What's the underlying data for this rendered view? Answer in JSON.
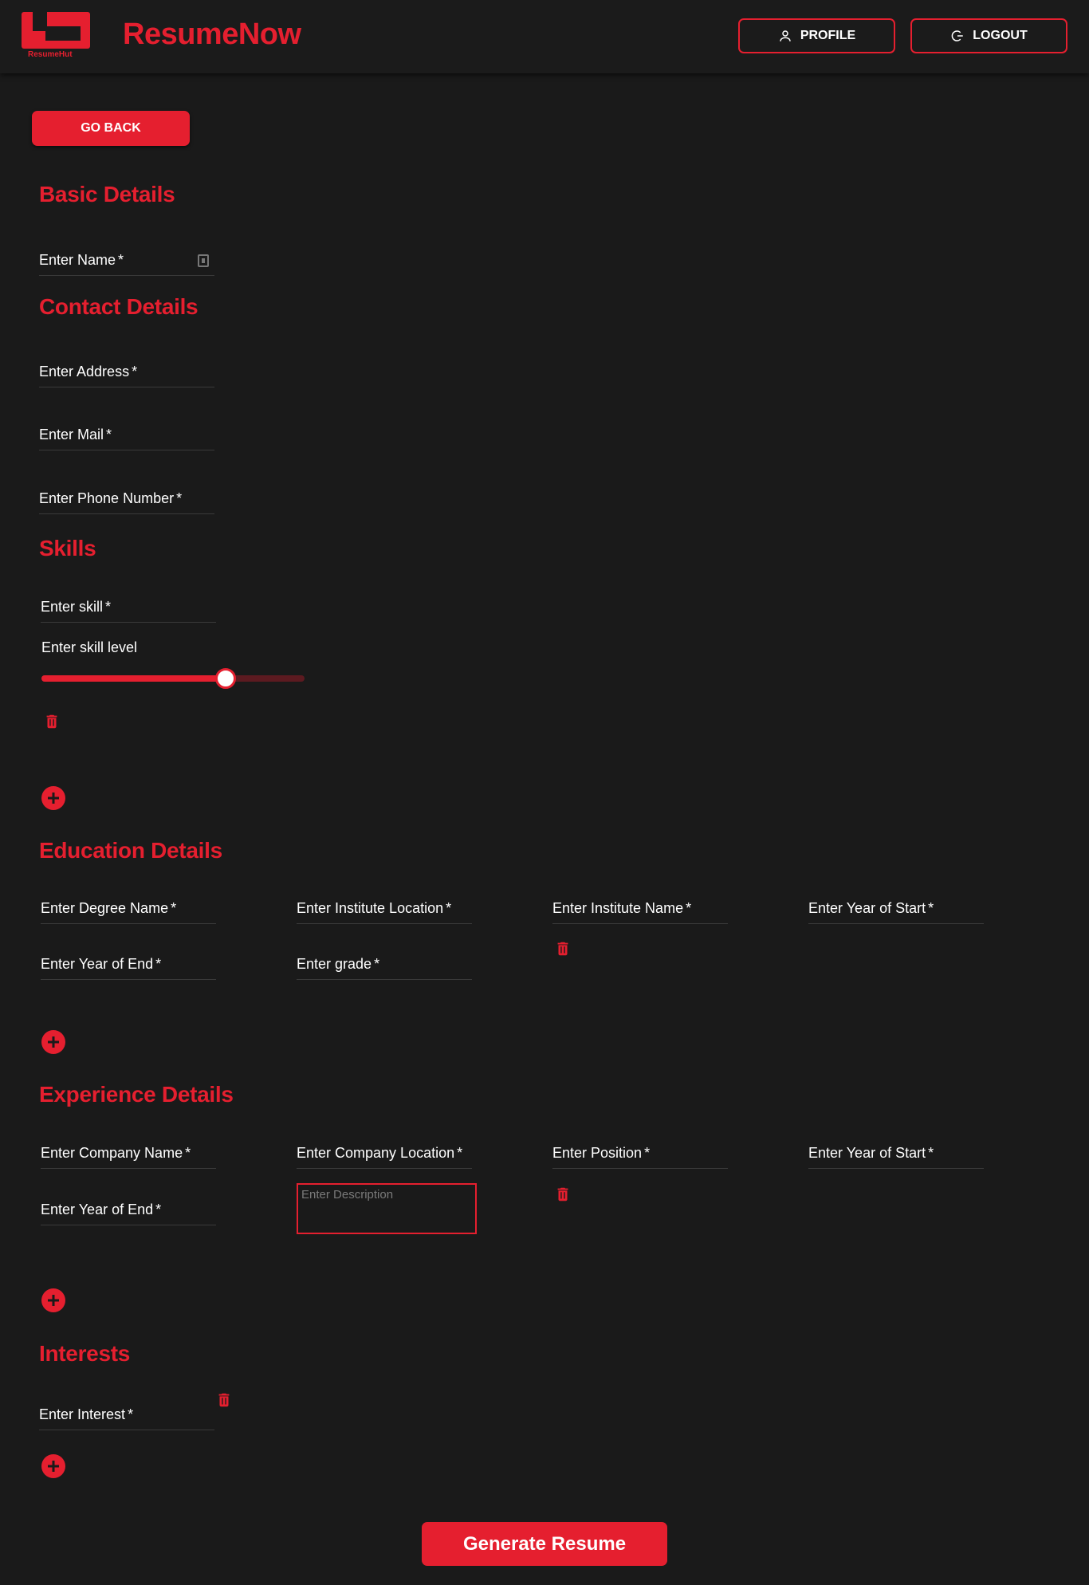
{
  "header": {
    "logo_text": "ResumeHut",
    "brand": "ResumeNow",
    "profile_label": "PROFILE",
    "logout_label": "LOGOUT"
  },
  "nav": {
    "go_back_label": "GO BACK"
  },
  "basic": {
    "title": "Basic Details",
    "name_label": "Enter Name"
  },
  "contact": {
    "title": "Contact Details",
    "address_label": "Enter Address",
    "mail_label": "Enter Mail",
    "phone_label": "Enter Phone Number"
  },
  "skills": {
    "title": "Skills",
    "skill_label": "Enter skill",
    "level_label": "Enter skill level",
    "level_value": 0.7
  },
  "education": {
    "title": "Education Details",
    "degree_label": "Enter Degree Name",
    "location_label": "Enter Institute Location",
    "institute_label": "Enter Institute Name",
    "start_label": "Enter Year of Start",
    "end_label": "Enter Year of End",
    "grade_label": "Enter grade"
  },
  "experience": {
    "title": "Experience Details",
    "company_label": "Enter Company Name",
    "location_label": "Enter Company Location",
    "position_label": "Enter Position",
    "start_label": "Enter Year of Start",
    "end_label": "Enter Year of End",
    "description_placeholder": "Enter Description"
  },
  "interests": {
    "title": "Interests",
    "interest_label": "Enter Interest"
  },
  "footer": {
    "generate_label": "Generate Resume"
  },
  "required_mark": "*",
  "colors": {
    "accent": "#e51f2f",
    "background": "#1a1a1a"
  }
}
